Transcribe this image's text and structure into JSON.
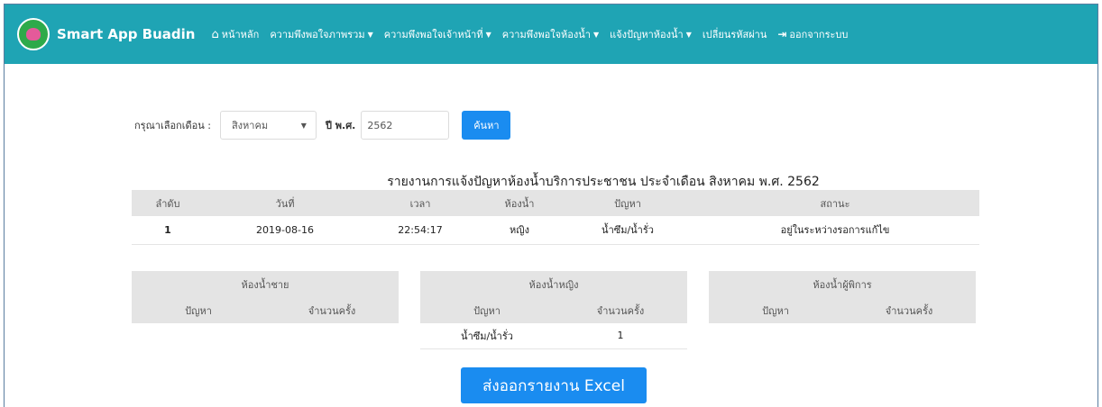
{
  "navbar": {
    "brand": "Smart App Buadin",
    "items": [
      {
        "label": "หน้าหลัก",
        "icon": "home-icon"
      },
      {
        "label": "ความพึงพอใจภาพรวม",
        "dropdown": true
      },
      {
        "label": "ความพึงพอใจเจ้าหน้าที่",
        "dropdown": true
      },
      {
        "label": "ความพึงพอใจห้องน้ำ",
        "dropdown": true
      },
      {
        "label": "แจ้งปัญหาห้องน้ำ",
        "dropdown": true
      },
      {
        "label": "เปลี่ยนรหัสผ่าน"
      },
      {
        "label": "ออกจากระบบ",
        "icon": "logout-icon"
      }
    ]
  },
  "filter": {
    "month_label": "กรุณาเลือกเดือน :",
    "month_value": "สิงหาคม",
    "year_label": "ปี พ.ศ.",
    "year_value": "2562",
    "search_label": "ค้นหา"
  },
  "report": {
    "title": "รายงานการแจ้งปัญหาห้องน้ำบริการประชาชน ประจำเดือน สิงหาคม พ.ศ. 2562",
    "columns": [
      "ลำดับ",
      "วันที่",
      "เวลา",
      "ห้องน้ำ",
      "ปัญหา",
      "สถานะ"
    ],
    "rows": [
      {
        "no": "1",
        "date": "2019-08-16",
        "time": "22:54:17",
        "room": "หญิง",
        "problem": "น้ำซึม/น้ำรั่ว",
        "status": "อยู่ในระหว่างรอการแก้ไข"
      }
    ]
  },
  "summary": {
    "male": {
      "title": "ห้องน้ำชาย",
      "col_problem": "ปัญหา",
      "col_count": "จำนวนครั้ง",
      "rows": []
    },
    "female": {
      "title": "ห้องน้ำหญิง",
      "col_problem": "ปัญหา",
      "col_count": "จำนวนครั้ง",
      "rows": [
        {
          "problem": "น้ำซึม/น้ำรั่ว",
          "count": "1"
        }
      ]
    },
    "disabled": {
      "title": "ห้องน้ำผู้พิการ",
      "col_problem": "ปัญหา",
      "col_count": "จำนวนครั้ง",
      "rows": []
    }
  },
  "export_label": "ส่งออกรายงาน Excel",
  "colors": {
    "navbar": "#1fa4b4",
    "primary_button": "#1a8cf0",
    "table_header": "#e4e4e4"
  }
}
